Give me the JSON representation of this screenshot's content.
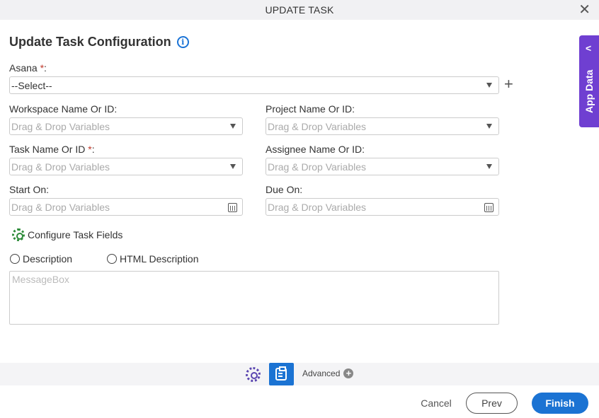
{
  "window": {
    "title": "UPDATE TASK",
    "close_label": "✕"
  },
  "page": {
    "heading": "Update Task Configuration",
    "info_icon": "i"
  },
  "asana": {
    "label": "Asana",
    "required": "*",
    "colon": ":",
    "value": "--Select--"
  },
  "fields": {
    "workspace": {
      "label": "Workspace Name Or ID:",
      "placeholder": "Drag & Drop Variables"
    },
    "project": {
      "label": "Project Name Or ID:",
      "placeholder": "Drag & Drop Variables"
    },
    "task": {
      "label": "Task Name Or ID ",
      "required": "*",
      "colon": ":",
      "placeholder": "Drag & Drop Variables"
    },
    "assignee": {
      "label": "Assignee Name Or ID:",
      "placeholder": "Drag & Drop Variables"
    },
    "start_on": {
      "label": "Start On:",
      "placeholder": "Drag & Drop Variables"
    },
    "due_on": {
      "label": "Due On:",
      "placeholder": "Drag & Drop Variables"
    }
  },
  "configure_fields": {
    "label": "Configure Task Fields"
  },
  "description_options": [
    {
      "label": "Description",
      "selected": false
    },
    {
      "label": "HTML Description",
      "selected": false
    }
  ],
  "message_box": {
    "placeholder": "MessageBox"
  },
  "side_panel": {
    "label": "App Data",
    "chevron": "<"
  },
  "toolbar": {
    "advanced_label": "Advanced",
    "advanced_icon": "+"
  },
  "footer": {
    "cancel": "Cancel",
    "prev": "Prev",
    "finish": "Finish"
  },
  "colors": {
    "primary": "#1b73d3",
    "app_data": "#6f3fd1",
    "required": "#c0392b",
    "config_gear": "#2e8b3a"
  }
}
